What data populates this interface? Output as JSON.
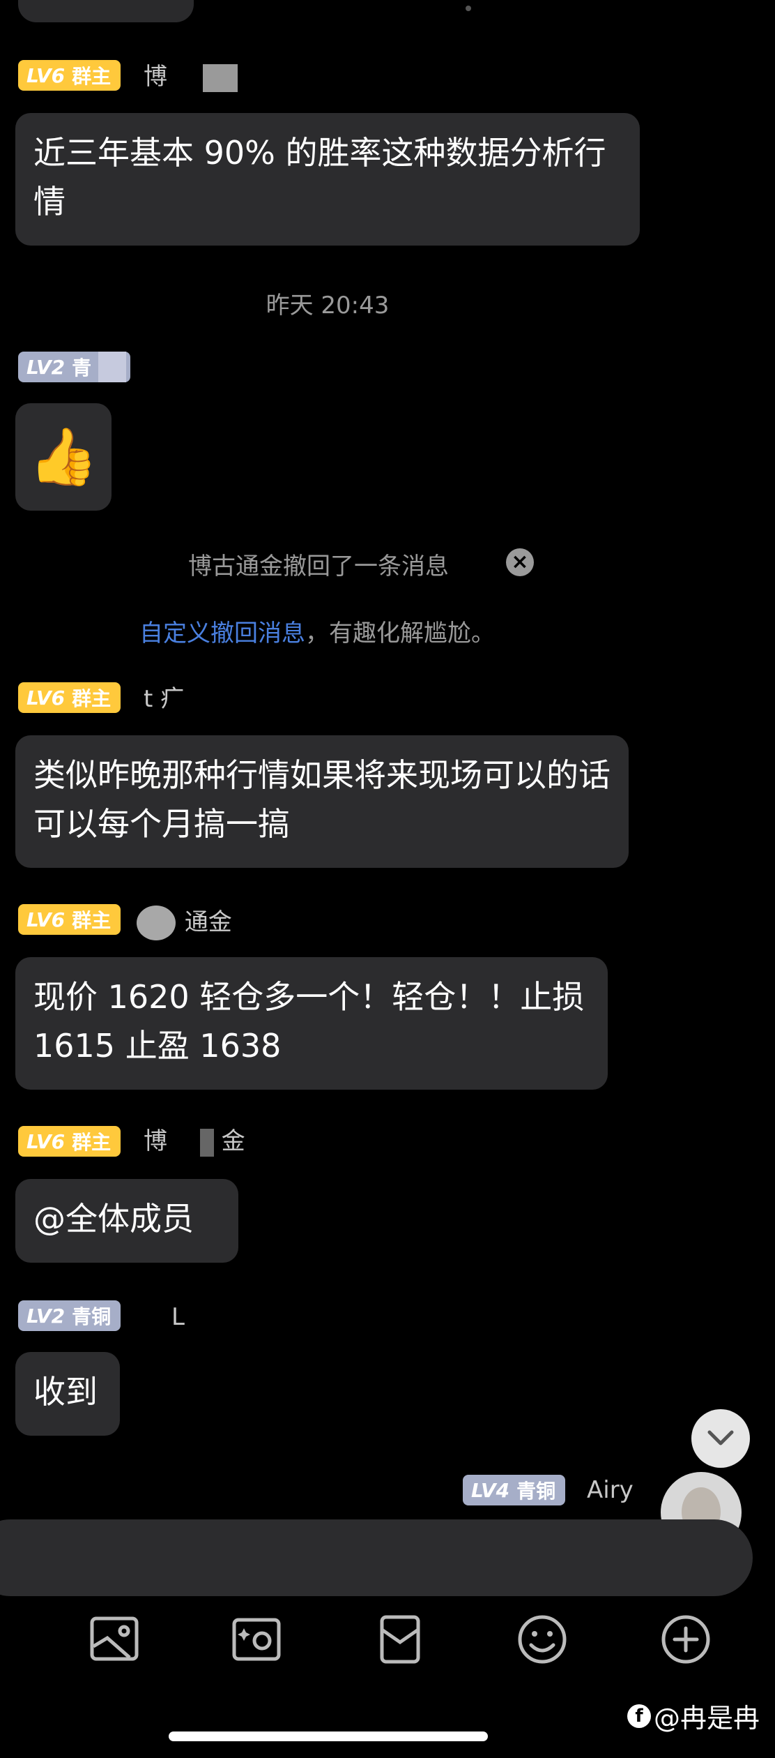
{
  "messages": [
    {
      "level": "LV6",
      "role": "群主",
      "nick": "博",
      "text": "近三年基本 90% 的胜率这种数据分析行情"
    },
    {
      "level": "LV2",
      "role": "青",
      "nick": "",
      "emoji": "👍"
    },
    {
      "level": "LV6",
      "role": "群主",
      "nick": "t   疒",
      "text": "类似昨晚那种行情如果将来现场可以的话可以每个月搞一搞"
    },
    {
      "level": "LV6",
      "role": "群主",
      "nick": "通金",
      "text": "现价 1620 轻仓多一个！轻仓！！止损 1615 止盈 1638"
    },
    {
      "level": "LV6",
      "role": "群主",
      "nick": "博",
      "nick2": "金",
      "text": "@全体成员"
    },
    {
      "level": "LV2",
      "role": "青铜",
      "nick": "L",
      "text": "收到"
    },
    {
      "level": "LV4",
      "role": "青铜",
      "nick": "Airy"
    }
  ],
  "timestamp": "昨天 20:43",
  "recall": {
    "text": "博古通金撤回了一条消息",
    "tip_link": "自定义撤回消息",
    "tip_rest": "，有趣化解尴尬。"
  },
  "toolbar": [
    "image-icon",
    "photo-camera-icon",
    "red-packet-icon",
    "emoji-icon",
    "plus-icon"
  ],
  "watermark": "@冉是冉",
  "colors": {
    "gold_badge": "#ffc93c",
    "silver_badge": "#a6aec8",
    "bubble": "#2c2c2e",
    "link": "#4a80e0"
  }
}
